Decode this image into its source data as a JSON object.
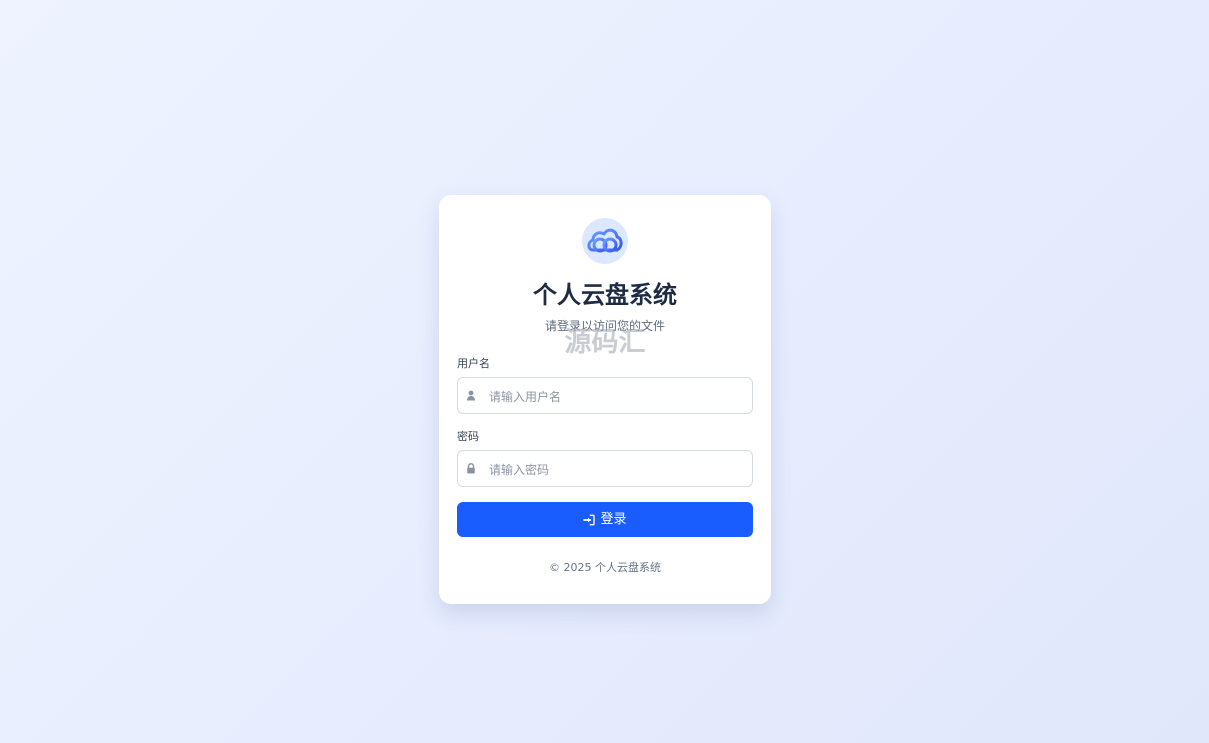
{
  "app": {
    "title": "个人云盘系统",
    "subtitle": "请登录以访问您的文件",
    "watermark": "源码汇"
  },
  "form": {
    "username_label": "用户名",
    "username_placeholder": "请输入用户名",
    "password_label": "密码",
    "password_placeholder": "请输入密码"
  },
  "actions": {
    "login_label": "登录"
  },
  "footer": {
    "copyright": "© 2025 个人云盘系统"
  },
  "icons": {
    "logo": "cloud-logo-icon",
    "username": "user-icon",
    "password": "lock-icon",
    "login": "sign-in-icon"
  },
  "colors": {
    "primary": "#1a5dff",
    "title": "#1f2b45",
    "background": "#e8eefe"
  }
}
